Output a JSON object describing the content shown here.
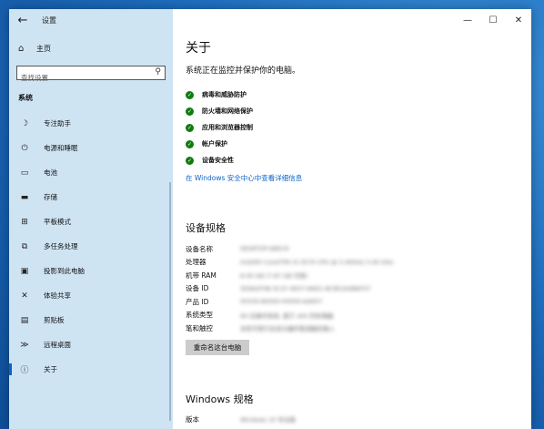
{
  "window": {
    "title": "设置",
    "back_icon": "←",
    "minimize_icon": "—",
    "maximize_icon": "☐",
    "close_icon": "✕"
  },
  "sidebar": {
    "home": {
      "icon": "⌂",
      "label": "主页"
    },
    "search": {
      "placeholder": "查找设置",
      "icon": "⚲"
    },
    "section_label": "系统",
    "items": [
      {
        "icon": "☽",
        "label": "专注助手",
        "active": false
      },
      {
        "icon": "⏻",
        "label": "电源和睡眠",
        "active": false
      },
      {
        "icon": "▭",
        "label": "电池",
        "active": false
      },
      {
        "icon": "▬",
        "label": "存储",
        "active": false
      },
      {
        "icon": "⊞",
        "label": "平板模式",
        "active": false
      },
      {
        "icon": "⧉",
        "label": "多任务处理",
        "active": false
      },
      {
        "icon": "▣",
        "label": "投影到此电脑",
        "active": false
      },
      {
        "icon": "✕",
        "label": "体验共享",
        "active": false
      },
      {
        "icon": "▤",
        "label": "剪贴板",
        "active": false
      },
      {
        "icon": "≫",
        "label": "远程桌面",
        "active": false
      },
      {
        "icon": "ⓘ",
        "label": "关于",
        "active": true
      }
    ]
  },
  "main": {
    "title": "关于",
    "monitor_text": "系统正在监控并保护你的电脑。",
    "status_items": [
      {
        "label": "病毒和威胁防护"
      },
      {
        "label": "防火墙和网络保护"
      },
      {
        "label": "应用和浏览器控制"
      },
      {
        "label": "帐户保护"
      },
      {
        "label": "设备安全性"
      }
    ],
    "security_link": "在 Windows 安全中心中查看详细信息",
    "device_specs_title": "设备规格",
    "device_specs": [
      {
        "key": "设备名称",
        "value": "DESKTOP-A8EC9"
      },
      {
        "key": "处理器",
        "value": "Intel(R) Core(TM) i5-3570 CPU @ 3.40GHz 3.40 GHz"
      },
      {
        "key": "机带 RAM",
        "value": "8.00 GB (7.87 GB 可用)"
      },
      {
        "key": "设备 ID",
        "value": "5E9A2F0B-3C1F-4E07-A6D1-8C9E2A4B6F07"
      },
      {
        "key": "产品 ID",
        "value": "00330-80000-00000-AA657"
      },
      {
        "key": "系统类型",
        "value": "64 位操作系统, 基于 x64 的处理器"
      },
      {
        "key": "笔和触控",
        "value": "没有可用于此显示器的笔或触控输入"
      }
    ],
    "rename_button": "重命名这台电脑",
    "windows_specs_title": "Windows 规格",
    "windows_spec_edition": {
      "key": "版本",
      "value": "Windows 10 专业版"
    }
  },
  "colors": {
    "accent": "#0a64c8",
    "check_green": "#107c10",
    "sidebar_bg": "#cfe4f3"
  }
}
